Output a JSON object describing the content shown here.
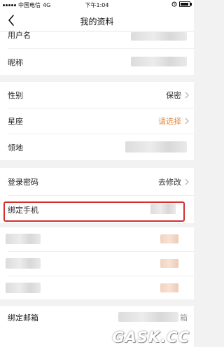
{
  "status_bar": {
    "carrier": "中国电信",
    "network": "4G",
    "time": "下午1:04",
    "battery_level": 0.9
  },
  "nav": {
    "title": "我的资料",
    "back_icon": "chevron-left-icon"
  },
  "group1": {
    "rows": [
      {
        "label": "用户名"
      },
      {
        "label": "昵称"
      }
    ]
  },
  "group2": {
    "rows": [
      {
        "label": "性别",
        "value": "保密"
      },
      {
        "label": "星座",
        "value": "请选择"
      },
      {
        "label": "领地"
      }
    ]
  },
  "group3": {
    "rows": [
      {
        "label": "登录密码",
        "value": "去修改"
      },
      {
        "label": "绑定手机"
      }
    ]
  },
  "group4": {
    "rows": [
      {
        "label": "绑定邮箱",
        "value": "箱"
      }
    ]
  },
  "colors": {
    "accent": "#e8873a",
    "highlight": "#d32f2f"
  },
  "watermark": "GASK.CC"
}
